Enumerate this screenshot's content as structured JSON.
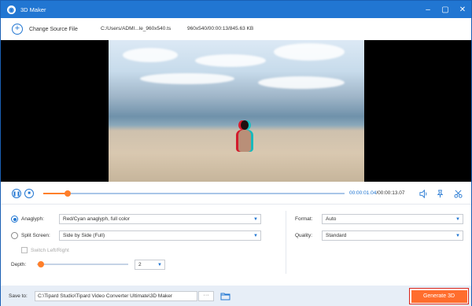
{
  "window": {
    "title": "3D Maker",
    "app_icon": "3d-maker-app-icon",
    "controls": [
      "minimize-icon",
      "restore-icon",
      "close-icon"
    ]
  },
  "source": {
    "change_label": "Change Source File",
    "path": "C:/Users/ADMI...le_960x540.ts",
    "meta": "960x540/00:00:13/845.63 KB"
  },
  "player": {
    "current_time": "00:00:01.04",
    "total_time": "/00:00:13.07",
    "progress": 0.08,
    "icons": [
      "pause-icon",
      "stop-icon",
      "volume-icon",
      "pin-icon",
      "cut-icon"
    ]
  },
  "settings": {
    "anaglyph": {
      "label": "Anaglyph:",
      "selected": true,
      "value": "Red/Cyan anaglyph, full color"
    },
    "split_screen": {
      "label": "Split Screen:",
      "selected": false,
      "value": "Side by Side (Full)"
    },
    "switch_lr": {
      "label": "Switch Left/Right",
      "checked": false,
      "disabled": true
    },
    "depth": {
      "label": "Depth:",
      "value": "2",
      "level": 0.02
    },
    "format": {
      "label": "Format:",
      "value": "Auto"
    },
    "quality": {
      "label": "Quality:",
      "value": "Standard"
    }
  },
  "footer": {
    "save_label": "Save to:",
    "save_path": "C:\\Tipard Studio\\Tipard Video Converter Ultimate\\3D Maker",
    "browse_label": "···",
    "generate_label": "Generate 3D"
  },
  "colors": {
    "accent": "#2176d2",
    "orange": "#ff6d2d",
    "highlight_border": "#d8261d"
  }
}
